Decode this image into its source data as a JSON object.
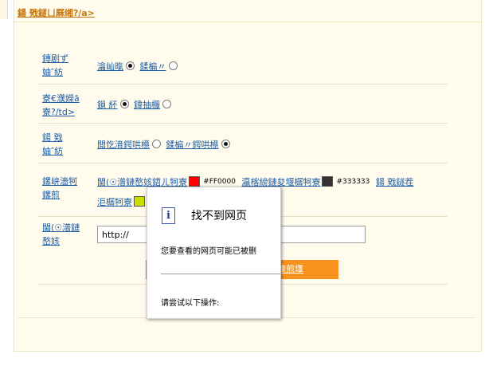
{
  "header": {
    "title": "鍚 戣鐩ㄩ厤缃?/a>"
  },
  "rows": [
    {
      "label_line1": "鏄剧ず",
      "label_line2": "妯″紡",
      "options": [
        {
          "label": "瀹屾暣",
          "selected": true
        },
        {
          "label": "鍒楄〃",
          "selected": false
        }
      ]
    },
    {
      "label_line1": "寮€濮嬫ā",
      "label_line2": "寮?/td>",
      "options": [
        {
          "label": "鎻 紑",
          "selected": true
        },
        {
          "label": "鍏抽棴",
          "selected": false
        }
      ]
    },
    {
      "label_line1": "鍚 戣",
      "label_line2": "妯″紡",
      "options": [
        {
          "label": "閲忔湇鍔哄櫒",
          "selected": false
        },
        {
          "label": "鍒楄〃鍔哄櫒",
          "selected": true
        }
      ]
    },
    {
      "label_line1": "鏍峅濇牱",
      "label_line2": "鏍煎",
      "color1_label": "閫(☉潽鏈嶅姟鍣ㄦ牱寮",
      "color1_hex": "#FF0000",
      "color2_label": "瀛楁縍鏈夋堰樼牱寮",
      "color2_hex": "#333333",
      "color3_label_a": "鍚 戣鐩茬",
      "color3_label_b": "洰樼牱寮",
      "color1": "#ff0000",
      "color2": "#333333",
      "color3": "#ccdd00"
    },
    {
      "label_line1": "閫(☉潽鏈",
      "label_line2": "嶅姟",
      "url_value": "http://"
    }
  ],
  "submit": {
    "label": "鍊煎墿"
  },
  "error_popup": {
    "icon": "info-icon",
    "title": "找不到网页",
    "message": "您要查看的网页可能已被删",
    "try_text": "请尝试以下操作:"
  }
}
